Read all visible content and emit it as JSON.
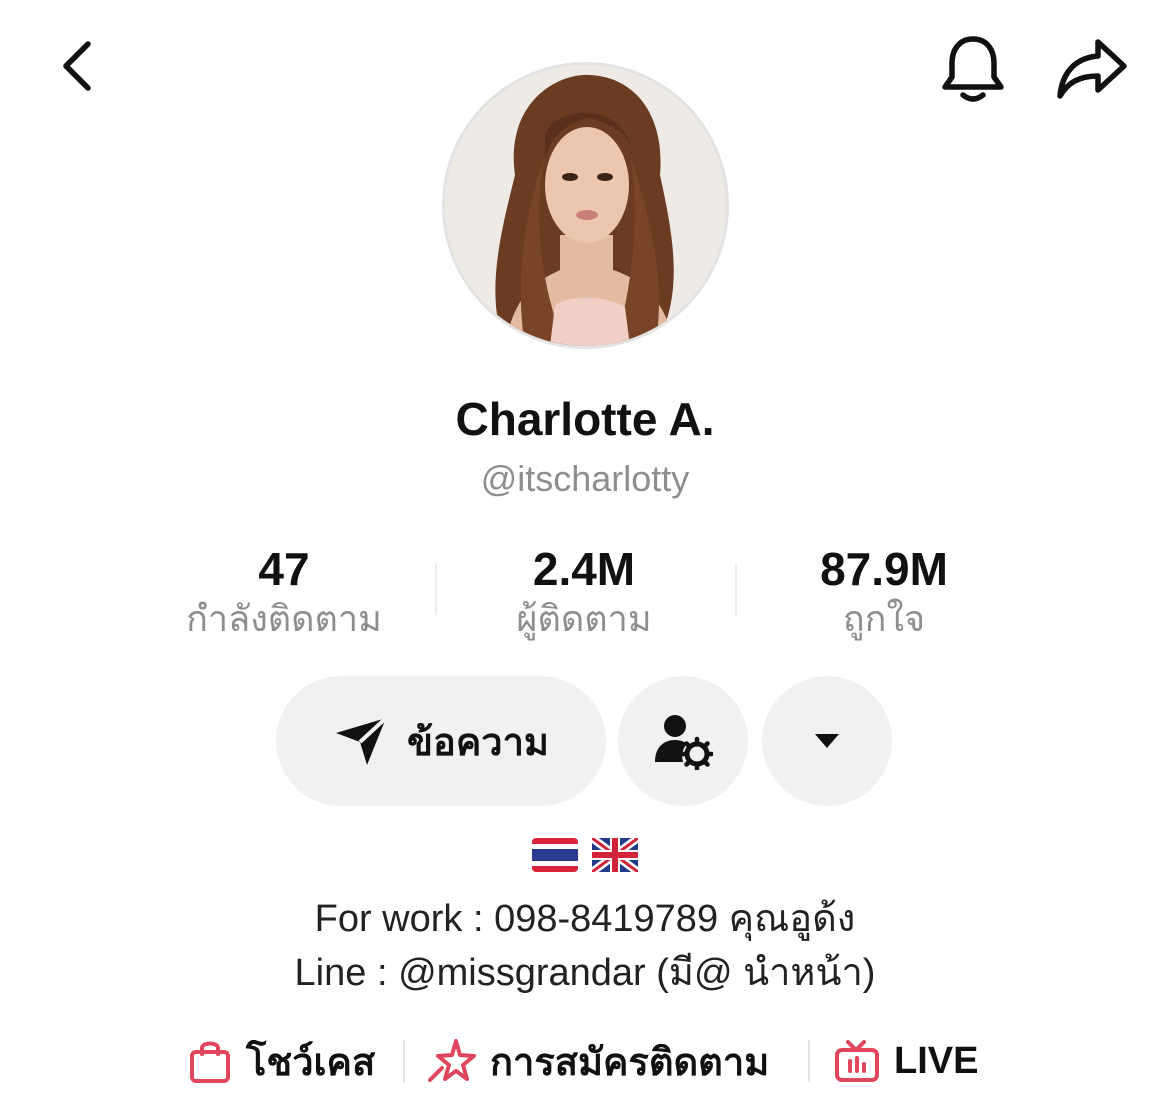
{
  "header": {
    "back_icon": "chevron-left-icon",
    "notification_icon": "bell-icon",
    "share_icon": "share-arrow-icon"
  },
  "profile": {
    "display_name": "Charlotte A.",
    "username": "@itscharlotty"
  },
  "stats": {
    "following": {
      "value": "47",
      "label": "กำลังติดตาม"
    },
    "followers": {
      "value": "2.4M",
      "label": "ผู้ติดตาม"
    },
    "likes": {
      "value": "87.9M",
      "label": "ถูกใจ"
    }
  },
  "actions": {
    "message_label": "ข้อความ",
    "message_icon": "paper-plane-icon",
    "friends_icon": "user-settings-icon",
    "more_icon": "caret-down-icon"
  },
  "bio": {
    "flags": [
      "🇹🇭",
      "🇬🇧"
    ],
    "line1": "For work : 098-8419789 คุณอูด้ง",
    "line2": "Line : @missgrandar (มี@ นำหน้า)"
  },
  "links": {
    "showcase": "โชว์เคส",
    "subscribe": "การสมัครติดตาม",
    "live": "LIVE"
  },
  "colors": {
    "accent_pink": "#e0455b",
    "muted_text": "#8e8e8e",
    "button_bg": "#f1f1f2"
  }
}
